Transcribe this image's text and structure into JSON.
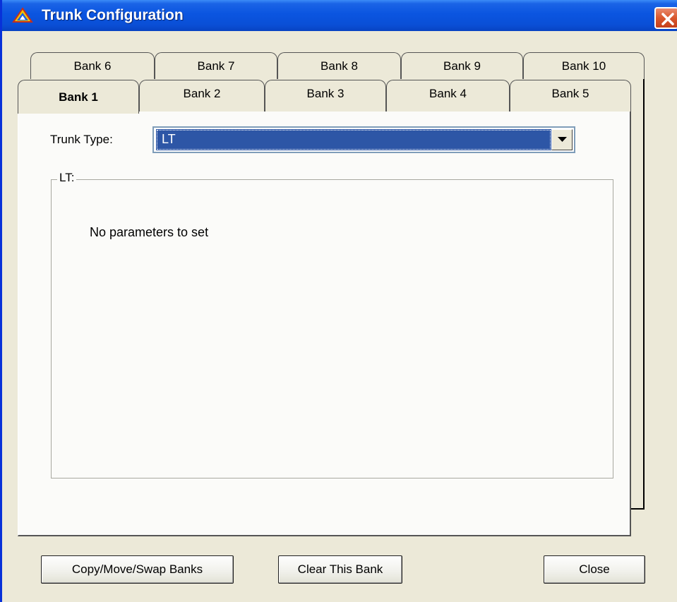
{
  "window": {
    "title": "Trunk Configuration"
  },
  "tabs": {
    "back_row": [
      "Bank 6",
      "Bank 7",
      "Bank 8",
      "Bank 9",
      "Bank 10"
    ],
    "front_row": [
      "Bank 1",
      "Bank 2",
      "Bank 3",
      "Bank 4",
      "Bank 5"
    ],
    "active": "Bank 1"
  },
  "form": {
    "trunk_type_label": "Trunk Type:",
    "trunk_type_value": "LT",
    "group_title": "LT:",
    "message": "No parameters to set"
  },
  "buttons": {
    "copy_move_swap": "Copy/Move/Swap Banks",
    "clear_bank": "Clear This Bank",
    "close": "Close"
  },
  "colors": {
    "titlebar": "#0b55e0",
    "selection": "#2d56a6",
    "close_button": "#d9572d"
  },
  "icons": {
    "title": "app-mountain-icon",
    "close": "close-x-icon",
    "dropdown": "chevron-down-icon"
  }
}
